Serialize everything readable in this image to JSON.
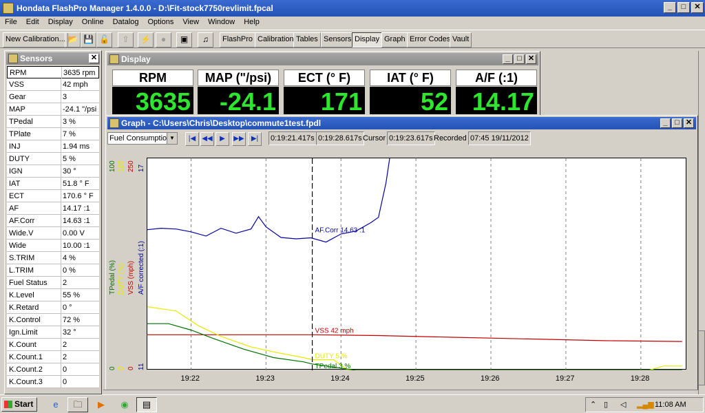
{
  "app": {
    "title": "Hondata FlashPro Manager 1.4.0.0 - D:\\Fit-stock7750revlimit.fpcal"
  },
  "menu": [
    "File",
    "Edit",
    "Display",
    "Online",
    "Datalog",
    "Options",
    "View",
    "Window",
    "Help"
  ],
  "toolbar": {
    "new_calibration": "New Calibration...",
    "tabs": [
      "FlashPro",
      "Calibration",
      "Tables",
      "Sensors",
      "Display",
      "Graph",
      "Error Codes",
      "Vault"
    ],
    "active_tab": "Display"
  },
  "sensors": {
    "title": "Sensors",
    "rows": [
      {
        "name": "RPM",
        "value": "3635 rpm"
      },
      {
        "name": "VSS",
        "value": "42 mph"
      },
      {
        "name": "Gear",
        "value": "3"
      },
      {
        "name": "MAP",
        "value": "-24.1 \"/psi"
      },
      {
        "name": "TPedal",
        "value": "3 %"
      },
      {
        "name": "TPlate",
        "value": "7 %"
      },
      {
        "name": "INJ",
        "value": "1.94 ms"
      },
      {
        "name": "DUTY",
        "value": "5 %"
      },
      {
        "name": "IGN",
        "value": "30 °"
      },
      {
        "name": "IAT",
        "value": "51.8 ° F"
      },
      {
        "name": "ECT",
        "value": "170.6 ° F"
      },
      {
        "name": "AF",
        "value": "14.17 :1"
      },
      {
        "name": "AF.Corr",
        "value": "14.63 :1"
      },
      {
        "name": "Wide.V",
        "value": "0.00 V"
      },
      {
        "name": "Wide",
        "value": "10.00 :1"
      },
      {
        "name": "S.TRIM",
        "value": "4 %"
      },
      {
        "name": "L.TRIM",
        "value": "0 %"
      },
      {
        "name": "Fuel Status",
        "value": "2"
      },
      {
        "name": "K.Level",
        "value": "55 %"
      },
      {
        "name": "K.Retard",
        "value": "0 °"
      },
      {
        "name": "K.Control",
        "value": "72 %"
      },
      {
        "name": "Ign.Limit",
        "value": "32 °"
      },
      {
        "name": "K.Count",
        "value": "2"
      },
      {
        "name": "K.Count.1",
        "value": "2"
      },
      {
        "name": "K.Count.2",
        "value": "0"
      },
      {
        "name": "K.Count.3",
        "value": "0"
      }
    ]
  },
  "display": {
    "title": "Display",
    "gauges": [
      {
        "label": "RPM",
        "value": "3635"
      },
      {
        "label": "MAP (\"/psi)",
        "value": "-24.1"
      },
      {
        "label": "ECT (° F)",
        "value": "171"
      },
      {
        "label": "IAT (° F)",
        "value": "52"
      },
      {
        "label": "A/F (:1)",
        "value": "14.17"
      }
    ]
  },
  "graph": {
    "title": "Graph - C:\\Users\\Chris\\Desktop\\commute1test.fpdl",
    "selector": "Fuel Consumption",
    "start_time": "0:19:21.417s",
    "end_time": "0:19:28.617s",
    "cursor_label": "Cursor",
    "cursor_time": "0:19:23.617s",
    "recorded_label": "Recorded",
    "recorded_value": "07:45 19/11/2012",
    "colors": {
      "tpedal": "#007000",
      "duty": "#e8e800",
      "vss": "#c00000",
      "afcorr": "#0000a0"
    }
  },
  "chart_data": {
    "type": "line",
    "x_ticks": [
      "19:22",
      "19:23",
      "19:24",
      "19:25",
      "19:26",
      "19:27",
      "19:28"
    ],
    "xlim_minutes": [
      21.417,
      28.617
    ],
    "cursor_x": 23.617,
    "axes": [
      {
        "label": "TPedal (%)",
        "min": "0",
        "max": "100",
        "color": "#007000"
      },
      {
        "label": "DUTY (%)",
        "min": "0",
        "max": "100",
        "color": "#e8e800"
      },
      {
        "label": "VSS (mph)",
        "min": "0",
        "max": "250",
        "color": "#c00000"
      },
      {
        "label": "A/F corrected (:1)",
        "min": "11",
        "max": "17",
        "color": "#0000a0"
      }
    ],
    "series": [
      {
        "name": "A/F corrected (:1)",
        "axis": 3,
        "ylim": [
          11,
          17
        ],
        "color": "#0000a0",
        "x": [
          21.417,
          21.6,
          21.8,
          22.0,
          22.2,
          22.4,
          22.6,
          22.8,
          22.9,
          23.0,
          23.2,
          23.4,
          23.6,
          23.8,
          24.0,
          24.2,
          24.4,
          24.5,
          24.6,
          24.65
        ],
        "y": [
          14.98,
          15.02,
          15.0,
          14.92,
          14.8,
          15.02,
          14.88,
          15.0,
          15.35,
          15.06,
          14.76,
          14.72,
          14.75,
          14.63,
          14.86,
          14.94,
          15.18,
          15.33,
          16.3,
          17.0
        ]
      },
      {
        "name": "VSS (mph)",
        "axis": 2,
        "ylim": [
          0,
          250
        ],
        "color": "#c00000",
        "x": [
          21.417,
          22.0,
          23.0,
          23.617,
          24.5,
          25.5,
          26.5,
          27.5,
          28.55
        ],
        "y": [
          42,
          42,
          42,
          42,
          41,
          39,
          37,
          35,
          34
        ]
      },
      {
        "name": "DUTY (%)",
        "axis": 1,
        "ylim": [
          0,
          100
        ],
        "color": "#e8e800",
        "x": [
          21.417,
          21.8,
          22.1,
          22.4,
          22.8,
          23.2,
          23.5,
          23.617,
          23.9,
          24.1,
          24.3,
          24.4,
          25.0,
          26.0,
          27.0,
          28.1,
          28.3,
          28.55
        ],
        "y": [
          30,
          28,
          21,
          16,
          11,
          8,
          6,
          5,
          5,
          0,
          0,
          0,
          0,
          0,
          0,
          0,
          2,
          2
        ]
      },
      {
        "name": "TPedal (%)",
        "axis": 0,
        "ylim": [
          0,
          100
        ],
        "color": "#007000",
        "x": [
          21.417,
          21.7,
          22.0,
          22.3,
          22.7,
          23.1,
          23.5,
          23.617,
          23.8,
          24.0,
          24.2,
          24.5,
          25.5,
          26.5,
          27.5,
          28.55
        ],
        "y": [
          22,
          22,
          19,
          15,
          10,
          6,
          4,
          3,
          2,
          1,
          0,
          0,
          0,
          0,
          0,
          0
        ]
      }
    ],
    "cursor_labels": [
      {
        "text": "AF.Corr 14.63 :1",
        "series": 0
      },
      {
        "text": "VSS 42 mph",
        "series": 1
      },
      {
        "text": "DUTY 5 %",
        "series": 2
      },
      {
        "text": "TPedal 3 %",
        "series": 3
      }
    ]
  },
  "taskbar": {
    "start": "Start",
    "clock": "11:08 AM"
  }
}
